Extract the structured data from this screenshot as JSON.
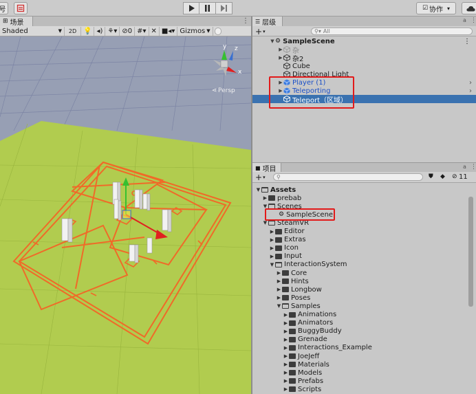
{
  "topbar": {
    "left_label": "号",
    "collab_label": "协作",
    "collab_arrow": "▾",
    "cloud_icon": "cloud-icon",
    "play_icon": "play-icon",
    "pause_icon": "pause-icon",
    "step_icon": "step-icon"
  },
  "scene": {
    "tab_label": "场景",
    "tab_menu": "⋮",
    "toolbar": {
      "shading_mode": "Shaded",
      "mode_2d": "2D",
      "fx_count": "0",
      "gizmos": "Gizmos"
    },
    "gizmo": {
      "y": "y",
      "z": "z",
      "x": "x",
      "persp": "Persp"
    }
  },
  "hierarchy": {
    "tab_label": "层级",
    "add_label": "+",
    "add_arrow": "▾",
    "search_placeholder": "All",
    "scene_name": "SampleScene",
    "items": [
      {
        "label": "杂",
        "faded": true
      },
      {
        "label": "杂2",
        "faded": false
      },
      {
        "label": "Cube"
      },
      {
        "label": "Directional Light"
      },
      {
        "label": "Player (1)"
      },
      {
        "label": "Teleporting"
      },
      {
        "label": "Teleport（区域）"
      }
    ],
    "menu_icon": "kebab-icon",
    "lock_icon": "lock-icon"
  },
  "project": {
    "tab_label": "项目",
    "add_label": "+",
    "add_arrow": "▾",
    "hidden_count": "11",
    "tree": [
      {
        "label": "Assets",
        "depth": 0,
        "open": true,
        "bold": true
      },
      {
        "label": "prebab",
        "depth": 1,
        "open": false
      },
      {
        "label": "Scenes",
        "depth": 1,
        "open": true
      },
      {
        "label": "SampleScene",
        "depth": 2,
        "scene": true
      },
      {
        "label": "SteamVR",
        "depth": 1,
        "open": true
      },
      {
        "label": "Editor",
        "depth": 2,
        "open": false
      },
      {
        "label": "Extras",
        "depth": 2,
        "open": false
      },
      {
        "label": "Icon",
        "depth": 2,
        "open": false
      },
      {
        "label": "Input",
        "depth": 2,
        "open": false
      },
      {
        "label": "InteractionSystem",
        "depth": 2,
        "open": true
      },
      {
        "label": "Core",
        "depth": 3,
        "open": false
      },
      {
        "label": "Hints",
        "depth": 3,
        "open": false
      },
      {
        "label": "Longbow",
        "depth": 3,
        "open": false
      },
      {
        "label": "Poses",
        "depth": 3,
        "open": false
      },
      {
        "label": "Samples",
        "depth": 3,
        "open": true
      },
      {
        "label": "Animations",
        "depth": 4,
        "open": false
      },
      {
        "label": "Animators",
        "depth": 4,
        "open": false
      },
      {
        "label": "BuggyBuddy",
        "depth": 4,
        "open": false
      },
      {
        "label": "Grenade",
        "depth": 4,
        "open": false
      },
      {
        "label": "Interactions_Example",
        "depth": 4,
        "open": false
      },
      {
        "label": "JoeJeff",
        "depth": 4,
        "open": false
      },
      {
        "label": "Materials",
        "depth": 4,
        "open": false
      },
      {
        "label": "Models",
        "depth": 4,
        "open": false
      },
      {
        "label": "Prefabs",
        "depth": 4,
        "open": false
      },
      {
        "label": "Scripts",
        "depth": 4,
        "open": false
      }
    ]
  },
  "colors": {
    "ground": "#b1cc4f",
    "sky": "#979fb4",
    "selection": "#3a72b0",
    "highlight": "#e21a1a",
    "teleport_outline": "#f06a28"
  }
}
